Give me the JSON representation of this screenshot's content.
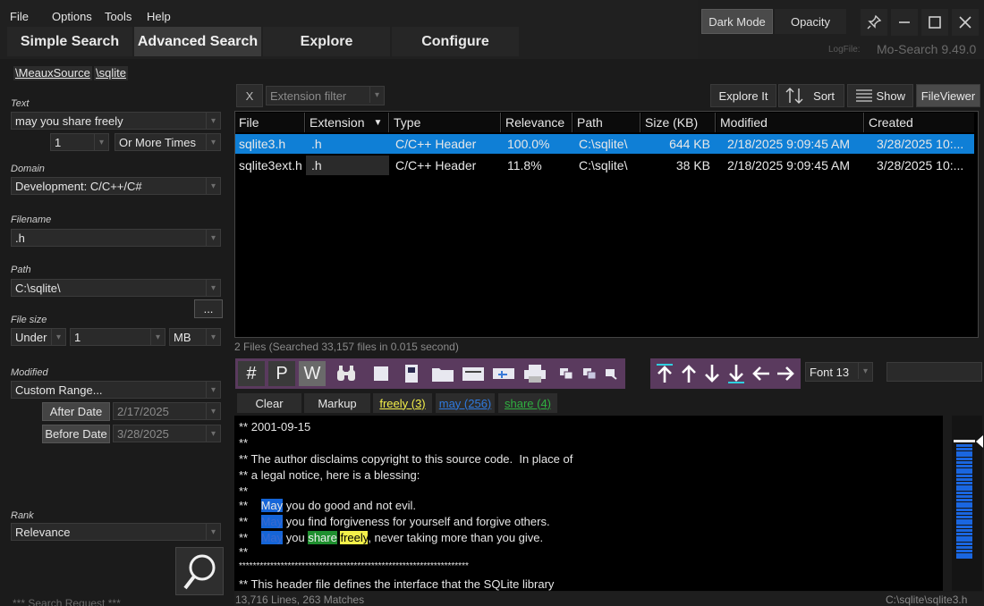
{
  "menu": {
    "file": "File",
    "options": "Options",
    "tools": "Tools",
    "help": "Help"
  },
  "tabs": {
    "simple": "Simple Search",
    "advanced": "Advanced Search",
    "explore": "Explore",
    "configure": "Configure"
  },
  "window": {
    "dark_mode": "Dark Mode",
    "opacity": "Opacity",
    "logfile_label": "LogFile:",
    "app_version": "Mo-Search 9.49.0"
  },
  "breadcrumbs": [
    "\\MeauxSource",
    "\\sqlite"
  ],
  "left": {
    "text_label": "Text",
    "text_value": "may you share freely",
    "count_value": "1",
    "count_mode": "Or More Times",
    "domain_label": "Domain",
    "domain_value": "Development: C/C++/C#",
    "filename_label": "Filename",
    "filename_value": ".h",
    "path_label": "Path",
    "path_value": "C:\\sqlite\\",
    "browse_label": "...",
    "filesize_label": "File size",
    "size_op": "Under",
    "size_value": "1",
    "size_unit": "MB",
    "modified_label": "Modified",
    "modified_value": "Custom Range...",
    "after_label": "After Date",
    "after_value": "2/17/2025",
    "before_label": "Before Date",
    "before_value": "3/28/2025",
    "rank_label": "Rank",
    "rank_value": "Relevance",
    "search_request": "*** Search Request ***"
  },
  "controls": {
    "clear_x": "X",
    "extension_filter_placeholder": "Extension filter",
    "explore_it": "Explore It",
    "sort": "Sort",
    "show": "Show",
    "fileviewer": "FileViewer"
  },
  "table": {
    "columns": [
      "File",
      "Extension",
      "Type",
      "Relevance",
      "Path",
      "Size (KB)",
      "Modified",
      "Created"
    ],
    "rows": [
      [
        "sqlite3.h",
        ".h",
        "C/C++ Header",
        "100.0%",
        "C:\\sqlite\\",
        "644 KB",
        "2/18/2025 9:09:45 AM",
        "3/28/2025 10:..."
      ],
      [
        "sqlite3ext.h",
        ".h",
        "C/C++ Header",
        "11.8%",
        "C:\\sqlite\\",
        "38 KB",
        "2/18/2025 9:09:45 AM",
        "3/28/2025 10:..."
      ]
    ]
  },
  "status": {
    "files": "2 Files  (Searched 33,157 files in 0.015 second)",
    "lines": "13,716 Lines, 263 Matches",
    "current_file": "C:\\sqlite\\sqlite3.h"
  },
  "toolbar": {
    "hash": "#",
    "p": "P",
    "w": "W",
    "font": "Font 13"
  },
  "tags": {
    "clear": "Clear",
    "markup": "Markup",
    "freely": "freely (3)",
    "may": "may (256)",
    "share": "share (4)"
  },
  "viewer": {
    "l1": "** 2001-09-15",
    "l2": "**",
    "l3": "** The author disclaims copyright to this source code.  In place of",
    "l4": "** a legal notice, here is a blessing:",
    "l5": "**",
    "l6a": "**    ",
    "w_may": "May",
    "l6b": " you do good and not evil.",
    "l7b": " you find forgiveness for yourself and forgive others.",
    "l8b1": " you ",
    "w_share": "share",
    "w_freely": "freely",
    "l8b2": ", never taking more than you give.",
    "l9": "**",
    "l10": "******************************************************************",
    "l11": "** This header file defines the interface that the SQLite library"
  },
  "colors": {
    "selected_row": "#0f7fd6",
    "toolbar_group": "#5a3a5e",
    "highlight_may": "#1565d8",
    "highlight_share": "#1f8f2f",
    "highlight_freely": "#f4f04a"
  }
}
